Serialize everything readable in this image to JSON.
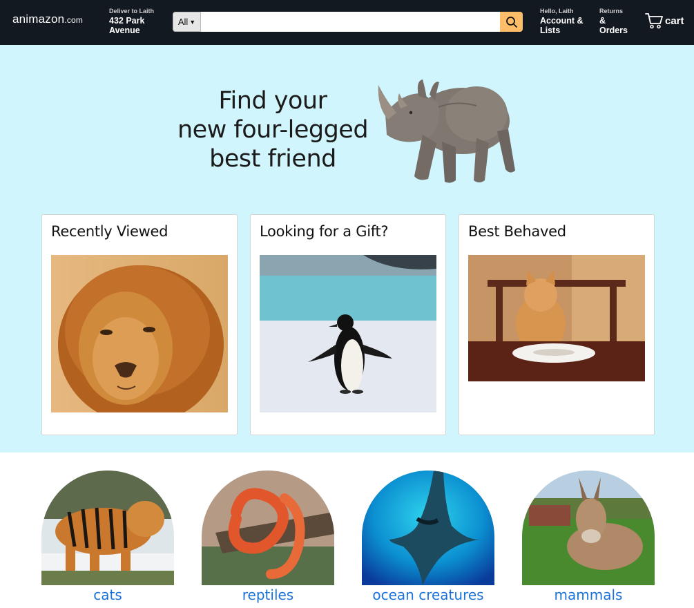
{
  "header": {
    "logo_main": "animazon",
    "logo_domain": ".com",
    "deliver_small": "Deliver to Laith",
    "deliver_big_1": "432 Park",
    "deliver_big_2": "Avenue",
    "search_category": "All",
    "search_value": "",
    "search_placeholder": "",
    "account_small": "Hello, Laith",
    "account_big_1": "Account &",
    "account_big_2": "Lists",
    "returns_small": "Returns",
    "returns_big_1": "&",
    "returns_big_2": "Orders",
    "cart_label": "cart"
  },
  "hero": {
    "title_line_1": "Find your",
    "title_line_2": "new four-legged",
    "title_line_3": "best friend"
  },
  "cards": [
    {
      "title": "Recently Viewed",
      "image": "lion"
    },
    {
      "title": "Looking for a Gift?",
      "image": "penguin"
    },
    {
      "title": "Best Behaved",
      "image": "cat-at-table"
    }
  ],
  "categories": [
    {
      "label": "cats",
      "image": "tiger"
    },
    {
      "label": "reptiles",
      "image": "snake"
    },
    {
      "label": "ocean creatures",
      "image": "manta-ray"
    },
    {
      "label": "mammals",
      "image": "donkey"
    }
  ],
  "colors": {
    "header_bg": "#131921",
    "search_button": "#febd69",
    "hero_bg": "#d0f5fc",
    "category_link": "#1a73d9"
  }
}
